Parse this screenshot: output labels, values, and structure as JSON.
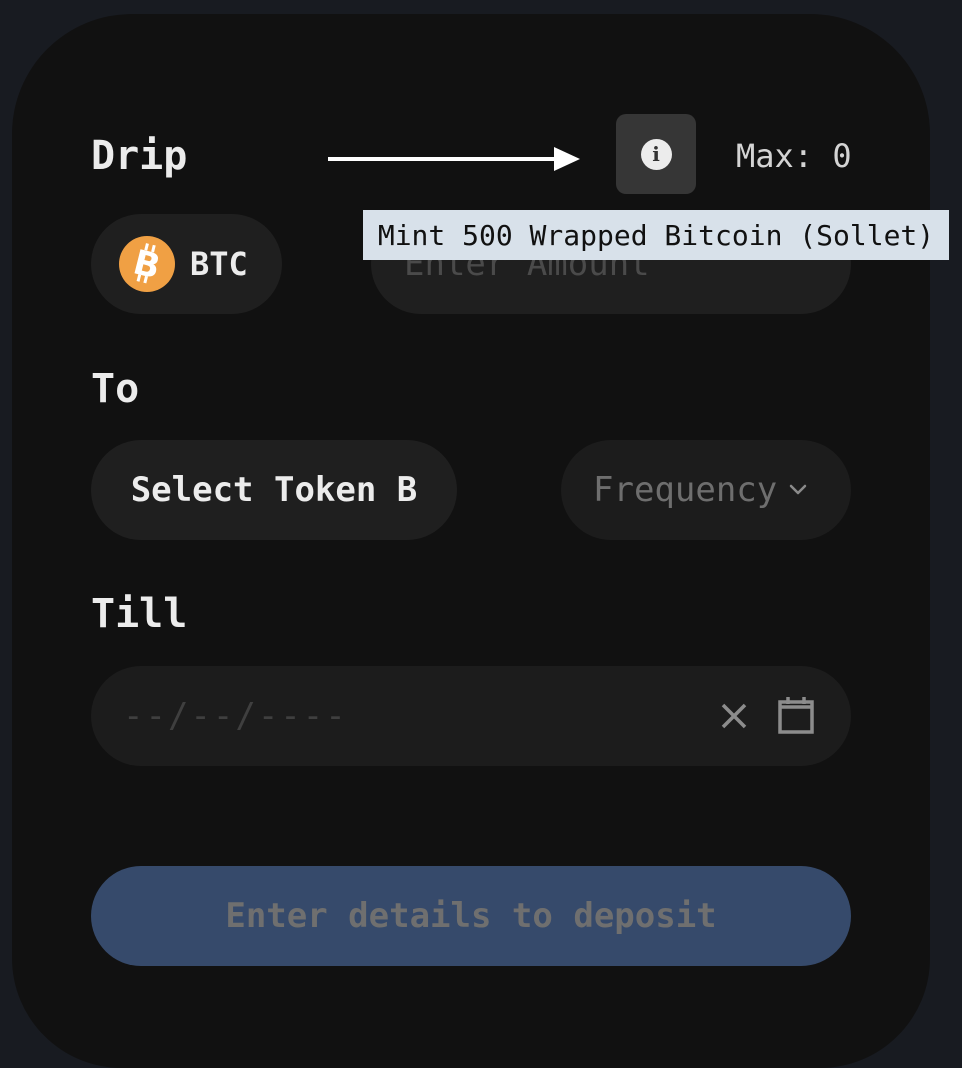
{
  "form": {
    "drip_label": "Drip",
    "to_label": "To",
    "till_label": "Till"
  },
  "source_token": {
    "symbol": "BTC",
    "icon": "bitcoin-icon",
    "icon_color": "#f0a044"
  },
  "amount": {
    "placeholder": "Enter Amount",
    "value": ""
  },
  "info": {
    "icon": "info-icon",
    "tooltip": "Mint 500 Wrapped Bitcoin (Sollet)"
  },
  "max": {
    "text": "Max: 0"
  },
  "target_token": {
    "label": "Select Token B"
  },
  "frequency": {
    "placeholder": "Frequency",
    "icon": "chevron-down-icon"
  },
  "end_date": {
    "placeholder": "--/--/----",
    "clear_icon": "close-icon",
    "calendar_icon": "calendar-icon"
  },
  "submit": {
    "label": "Enter details to deposit",
    "disabled": true
  },
  "colors": {
    "background": "#181b21",
    "card": "#111111",
    "field": "#1f1f1f",
    "submit_disabled": "#364a6b",
    "tooltip": "#d8e1ea"
  }
}
